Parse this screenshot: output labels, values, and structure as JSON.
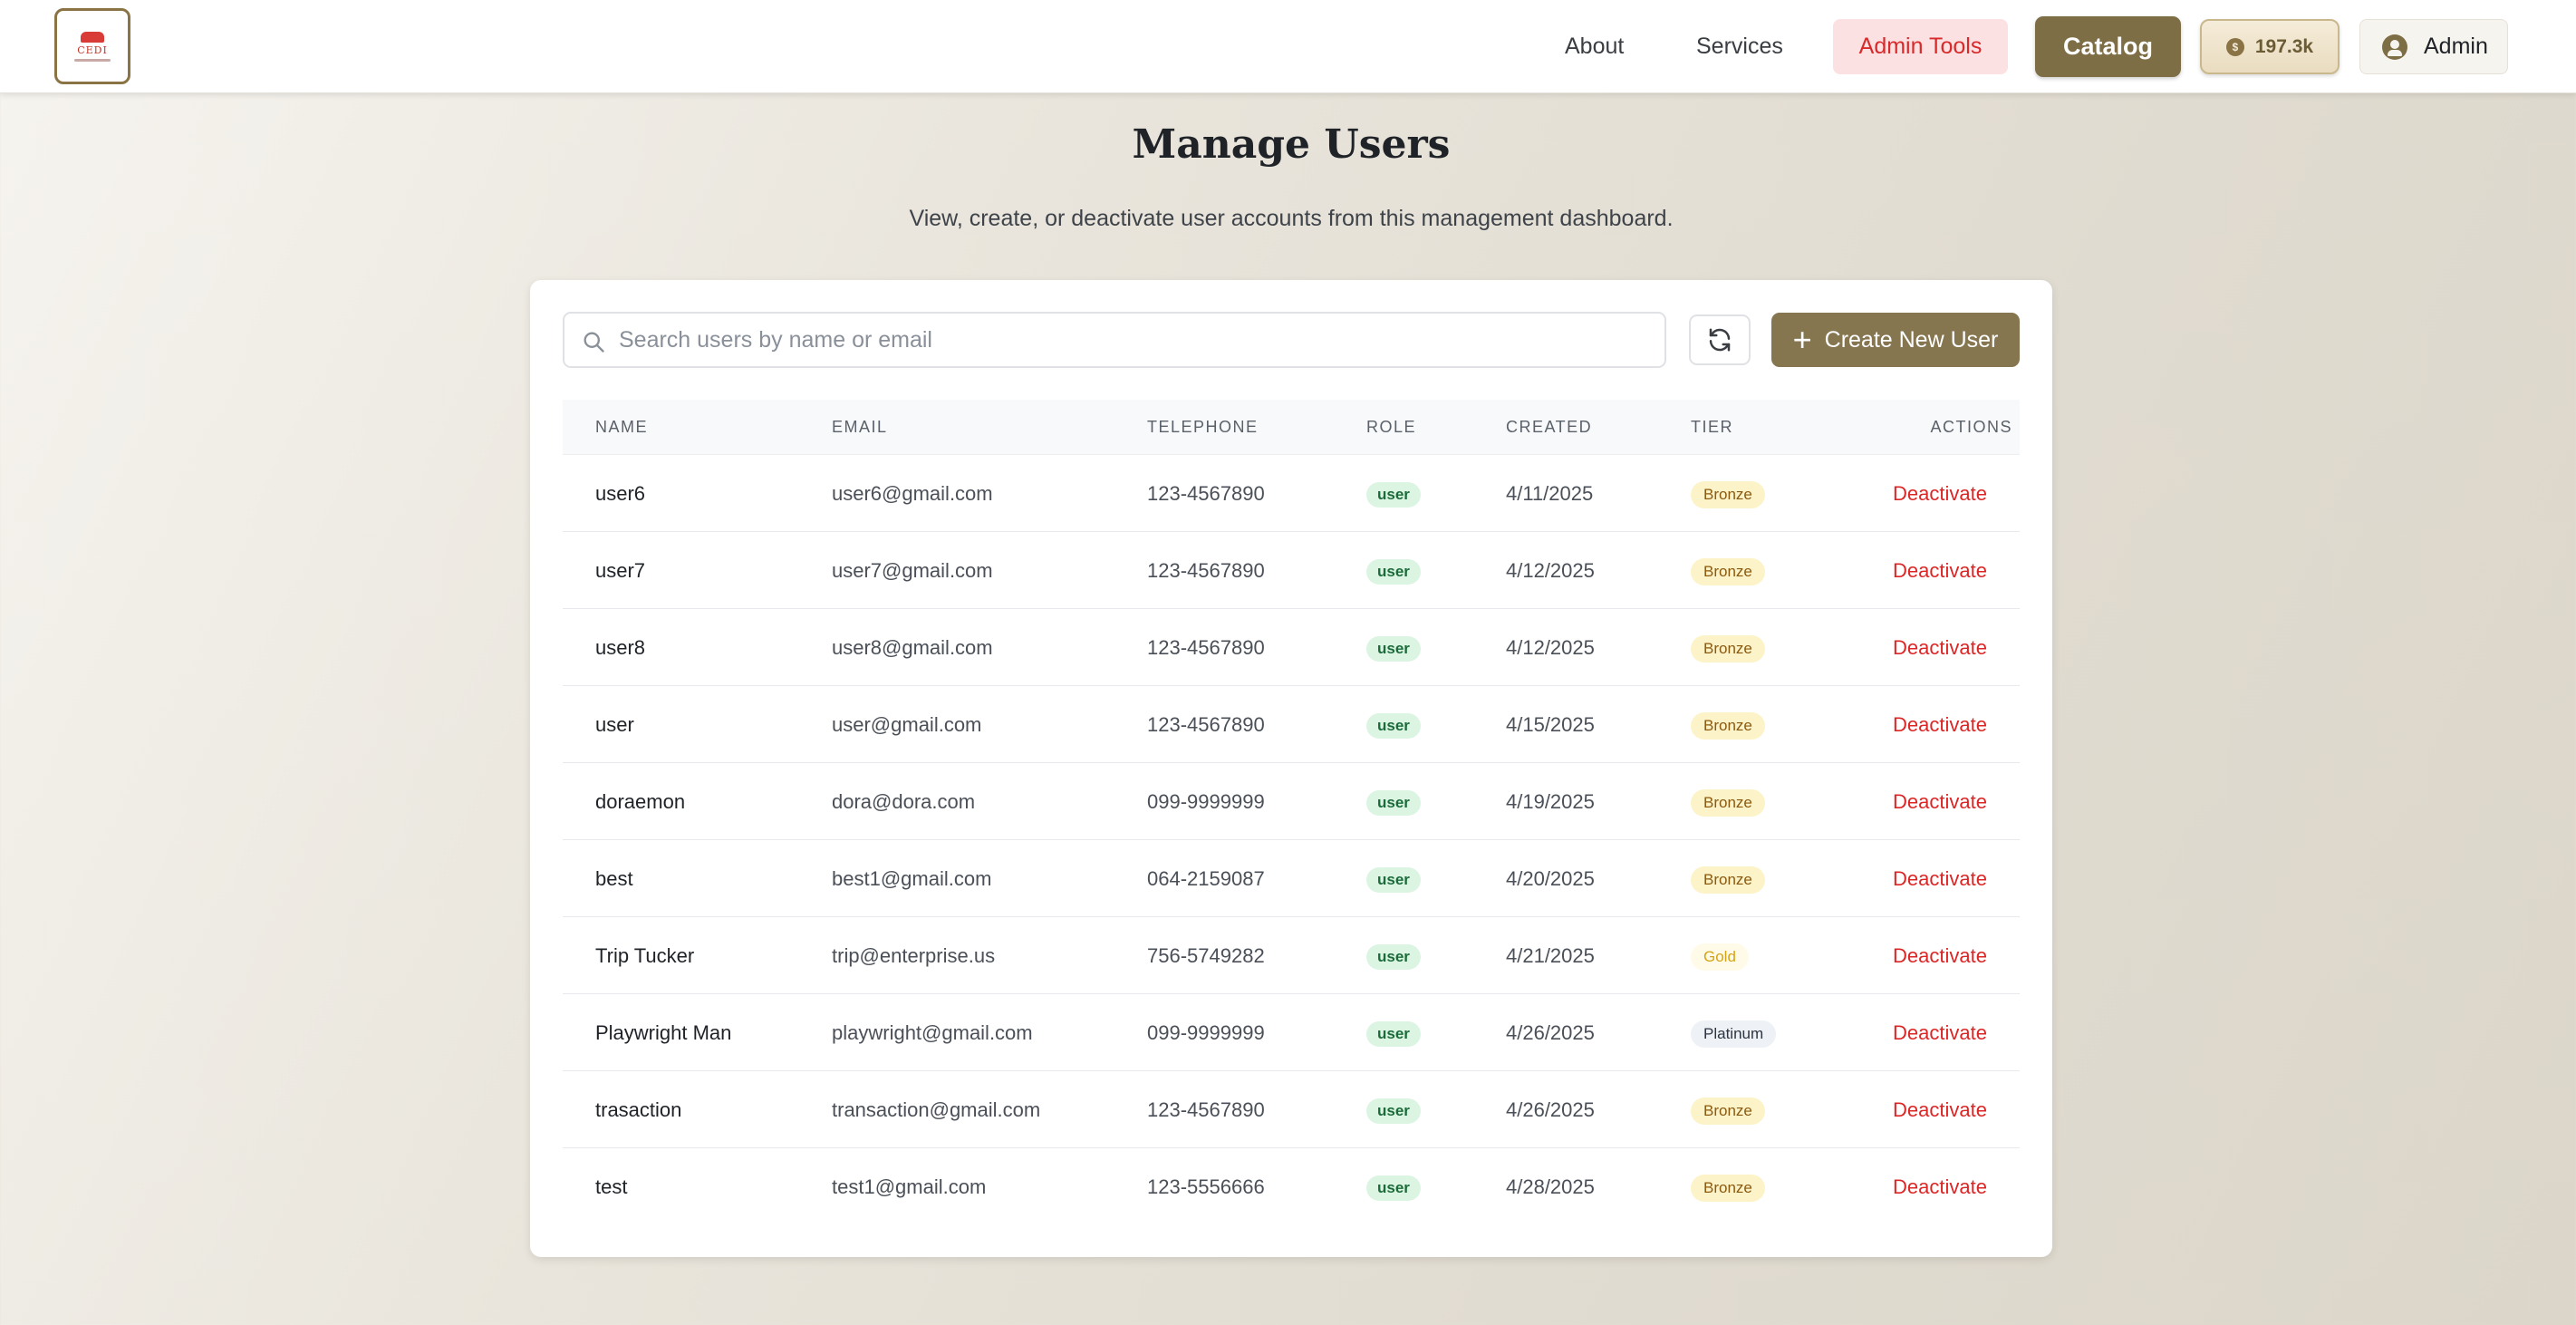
{
  "header": {
    "logo_text": "CEDI",
    "nav": [
      {
        "label": "About"
      },
      {
        "label": "Services"
      }
    ],
    "admin_tools_label": "Admin Tools",
    "catalog_label": "Catalog",
    "balance": "197.3k",
    "coin_symbol": "$",
    "user_label": "Admin"
  },
  "page": {
    "title": "Manage Users",
    "subtitle": "View, create, or deactivate user accounts from this management dashboard."
  },
  "toolbar": {
    "search_placeholder": "Search users by name or email",
    "search_value": "",
    "create_label": "Create New User"
  },
  "table": {
    "headers": {
      "name": "NAME",
      "email": "EMAIL",
      "telephone": "TELEPHONE",
      "role": "ROLE",
      "created": "CREATED",
      "tier": "TIER",
      "actions": "ACTIONS"
    },
    "rows": [
      {
        "name": "user6",
        "email": "user6@gmail.com",
        "telephone": "123-4567890",
        "role": "user",
        "created": "4/11/2025",
        "tier": "Bronze",
        "action": "Deactivate"
      },
      {
        "name": "user7",
        "email": "user7@gmail.com",
        "telephone": "123-4567890",
        "role": "user",
        "created": "4/12/2025",
        "tier": "Bronze",
        "action": "Deactivate"
      },
      {
        "name": "user8",
        "email": "user8@gmail.com",
        "telephone": "123-4567890",
        "role": "user",
        "created": "4/12/2025",
        "tier": "Bronze",
        "action": "Deactivate"
      },
      {
        "name": "user",
        "email": "user@gmail.com",
        "telephone": "123-4567890",
        "role": "user",
        "created": "4/15/2025",
        "tier": "Bronze",
        "action": "Deactivate"
      },
      {
        "name": "doraemon",
        "email": "dora@dora.com",
        "telephone": "099-9999999",
        "role": "user",
        "created": "4/19/2025",
        "tier": "Bronze",
        "action": "Deactivate"
      },
      {
        "name": "best",
        "email": "best1@gmail.com",
        "telephone": "064-2159087",
        "role": "user",
        "created": "4/20/2025",
        "tier": "Bronze",
        "action": "Deactivate"
      },
      {
        "name": "Trip Tucker",
        "email": "trip@enterprise.us",
        "telephone": "756-5749282",
        "role": "user",
        "created": "4/21/2025",
        "tier": "Gold",
        "action": "Deactivate"
      },
      {
        "name": "Playwright Man",
        "email": "playwright@gmail.com",
        "telephone": "099-9999999",
        "role": "user",
        "created": "4/26/2025",
        "tier": "Platinum",
        "action": "Deactivate"
      },
      {
        "name": "trasaction",
        "email": "transaction@gmail.com",
        "telephone": "123-4567890",
        "role": "user",
        "created": "4/26/2025",
        "tier": "Bronze",
        "action": "Deactivate"
      },
      {
        "name": "test",
        "email": "test1@gmail.com",
        "telephone": "123-5556666",
        "role": "user",
        "created": "4/28/2025",
        "tier": "Bronze",
        "action": "Deactivate"
      }
    ]
  },
  "colors": {
    "accent": "#7e6e46",
    "danger": "#dc2626",
    "admin_tools_bg": "#fbe1e1",
    "role_badge_bg": "#dcf5e3",
    "bronze_bg": "#fdf3c9"
  },
  "icons": {
    "search": "search-icon",
    "refresh": "refresh-icon",
    "plus": "plus-icon",
    "coin": "coin-icon",
    "user": "user-circle-icon"
  }
}
